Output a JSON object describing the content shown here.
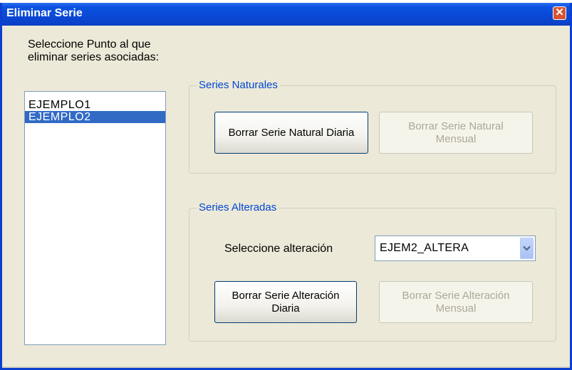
{
  "window": {
    "title": "Eliminar Serie",
    "close_glyph": "✕"
  },
  "points": {
    "prompt": "Seleccione Punto al que eliminar series asociadas:",
    "items": [
      {
        "label": "EJEMPLO1",
        "selected": false
      },
      {
        "label": "EJEMPLO2",
        "selected": true
      }
    ]
  },
  "natural": {
    "title": "Series Naturales",
    "daily_button": "Borrar Serie Natural Diaria",
    "monthly_button": "Borrar Serie Natural Mensual"
  },
  "altered": {
    "title": "Series Alteradas",
    "select_label": "Seleccione alteración",
    "selected_alteration": "EJEM2_ALTERA",
    "daily_button": "Borrar Serie Alteración Diaria",
    "monthly_button": "Borrar Serie Alteración Mensual"
  },
  "colors": {
    "titlebar": "#0a48d6",
    "selection": "#316ac5",
    "group_title": "#0046d5"
  }
}
